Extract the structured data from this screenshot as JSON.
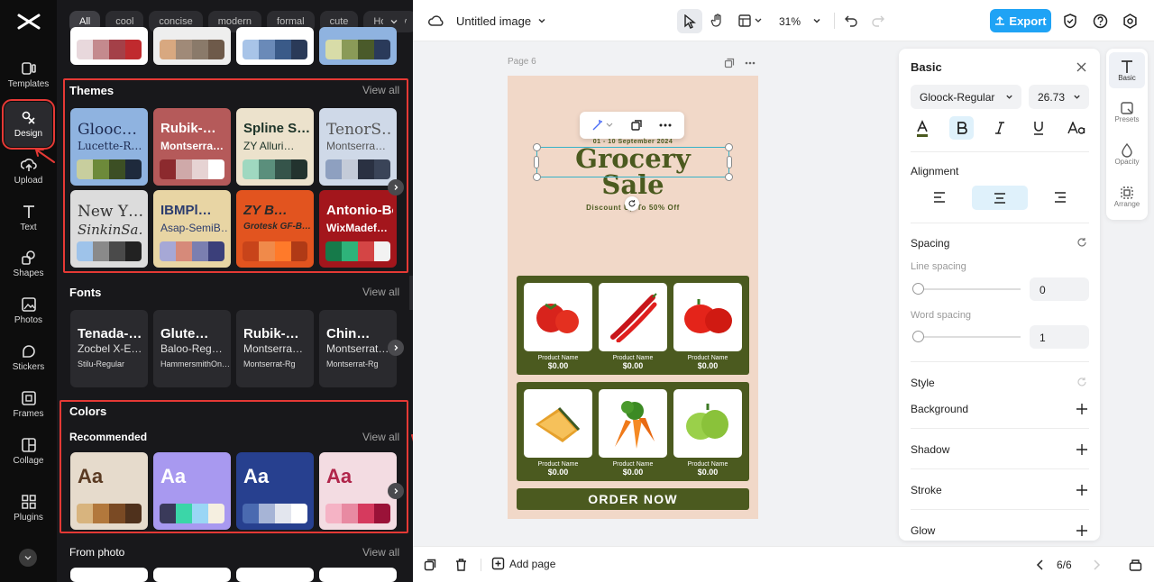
{
  "nav": {
    "items": [
      {
        "label": "Templates",
        "icon": "templates-icon"
      },
      {
        "label": "Design",
        "icon": "design-icon"
      },
      {
        "label": "Upload",
        "icon": "upload-icon"
      },
      {
        "label": "Text",
        "icon": "text-icon"
      },
      {
        "label": "Shapes",
        "icon": "shapes-icon"
      },
      {
        "label": "Photos",
        "icon": "photos-icon"
      },
      {
        "label": "Stickers",
        "icon": "stickers-icon"
      },
      {
        "label": "Frames",
        "icon": "frames-icon"
      },
      {
        "label": "Collage",
        "icon": "collage-icon"
      },
      {
        "label": "Plugins",
        "icon": "plugins-icon"
      }
    ]
  },
  "filters": [
    "All",
    "cool",
    "concise",
    "modern",
    "formal",
    "cute",
    "Holiday"
  ],
  "themes": {
    "title": "Themes",
    "view_all": "View all",
    "cards": [
      {
        "t1": "Glooc…",
        "t2": "Lucette-R…",
        "bg": "#8fb3e0",
        "fg": "#1d2a50",
        "swatches": [
          "#c8ce9e",
          "#6d8a3a",
          "#3c4f24",
          "#1e2a3c"
        ]
      },
      {
        "t1": "Rubik-…",
        "t2": "Montserra…",
        "bg": "#b55a5a",
        "fg": "#ffffff",
        "swatches": [
          "#8c2a2e",
          "#cfa9a9",
          "#e6d3d3",
          "#ffffff"
        ]
      },
      {
        "t1": "Spline S…",
        "t2": "ZY Alluri…",
        "bg": "#ece2cc",
        "fg": "#1c3328",
        "swatches": [
          "#9fd8c0",
          "#5b8f7c",
          "#35544a",
          "#22332e"
        ]
      },
      {
        "t1": "TenorS…",
        "t2": "Montserra…",
        "bg": "#cfd9e8",
        "fg": "#555",
        "swatches": [
          "#8ea0c0",
          "#c4cbd8",
          "#2a3142",
          "#3a4458"
        ]
      },
      {
        "t1": "New Y…",
        "t2": "SinkinSa…",
        "bg": "#dcdcdc",
        "fg": "#333",
        "swatches": [
          "#9ec3ea",
          "#8a8a8a",
          "#4a4a4a",
          "#222"
        ]
      },
      {
        "t1": "IBMPl…",
        "t2": "Asap-SemiB…",
        "bg": "#e8d5a4",
        "fg": "#2b3c6e",
        "swatches": [
          "#a6a8d6",
          "#d68a7a",
          "#7b7fb0",
          "#3b3f7a"
        ]
      },
      {
        "t1": "ZY B…",
        "t2": "Grotesk GF-B…",
        "bg": "#e2541f",
        "fg": "#2a2a2a",
        "swatches": [
          "#c8441a",
          "#f08a4a",
          "#ff7a2a",
          "#b03a16"
        ]
      },
      {
        "t1": "Antonio-Bold",
        "t2": "WixMadef…",
        "bg": "#a3161c",
        "fg": "#ffffff",
        "swatches": [
          "#167a4a",
          "#2eb37a",
          "#d44545",
          "#f2f2f2"
        ]
      }
    ]
  },
  "fonts": {
    "title": "Fonts",
    "view_all": "View all",
    "cards": [
      {
        "f1": "Tenada-…",
        "f2": "Zocbel X-E…",
        "f3": "Stilu-Regular"
      },
      {
        "f1": "Glute…",
        "f2": "Baloo-Reg…",
        "f3": "HammersmithOn…"
      },
      {
        "f1": "Rubik-…",
        "f2": "Montserra…",
        "f3": "Montserrat-Rg"
      },
      {
        "f1": "Chin…",
        "f2": "Montserrat…",
        "f3": "Montserrat-Rg"
      }
    ]
  },
  "colors": {
    "title": "Colors",
    "recommended": "Recommended",
    "view_all": "View all",
    "cards": [
      {
        "label": "Aa",
        "bg": "#e6dbcc",
        "fg": "#5a3a22",
        "swatches": [
          "#d8b47e",
          "#b2783c",
          "#7a4a24",
          "#4f311c"
        ]
      },
      {
        "label": "Aa",
        "bg": "#a899f0",
        "fg": "#ffffff",
        "swatches": [
          "#3a3a5a",
          "#3bd6a8",
          "#9ad6f5",
          "#f5efe0"
        ]
      },
      {
        "label": "Aa",
        "bg": "#27408f",
        "fg": "#ffffff",
        "swatches": [
          "#4a6ab0",
          "#a6b4d6",
          "#e3e6ee",
          "#ffffff"
        ]
      },
      {
        "label": "Aa",
        "bg": "#f3dce2",
        "fg": "#b0254a",
        "swatches": [
          "#f5b3c5",
          "#e88aa2",
          "#d63a5e",
          "#9a1238"
        ]
      }
    ]
  },
  "from_photo": {
    "title": "From photo",
    "view_all": "View all"
  },
  "topbar": {
    "doc_title": "Untitled image",
    "zoom": "31%",
    "export_label": "Export"
  },
  "canvas": {
    "page_label": "Page 6"
  },
  "poster": {
    "date": "01 - 10 September 2024",
    "title_line1": "Grocery",
    "title_line2": "Sale",
    "discount": "Discount Up To 50% Off",
    "products": [
      {
        "name": "Product Name",
        "price": "$0.00",
        "icon": "tomato"
      },
      {
        "name": "Product Name",
        "price": "$0.00",
        "icon": "chili"
      },
      {
        "name": "Product Name",
        "price": "$0.00",
        "icon": "bell-pepper"
      },
      {
        "name": "Product Name",
        "price": "$0.00",
        "icon": "pumpkin"
      },
      {
        "name": "Product Name",
        "price": "$0.00",
        "icon": "carrot"
      },
      {
        "name": "Product Name",
        "price": "$0.00",
        "icon": "green-pepper"
      }
    ],
    "cta": "ORDER NOW"
  },
  "right_panel": {
    "title": "Basic",
    "font_name": "Gloock-Regular",
    "font_size": "26.73",
    "alignment_label": "Alignment",
    "spacing_label": "Spacing",
    "line_spacing_label": "Line spacing",
    "line_spacing_value": "0",
    "word_spacing_label": "Word spacing",
    "word_spacing_value": "1",
    "style_label": "Style",
    "style_items": [
      "Background",
      "Shadow",
      "Stroke",
      "Glow"
    ]
  },
  "rail": [
    "Basic",
    "Presets",
    "Opacity",
    "Arrange"
  ],
  "bottombar": {
    "add_page": "Add page",
    "page_counter": "6/6"
  }
}
